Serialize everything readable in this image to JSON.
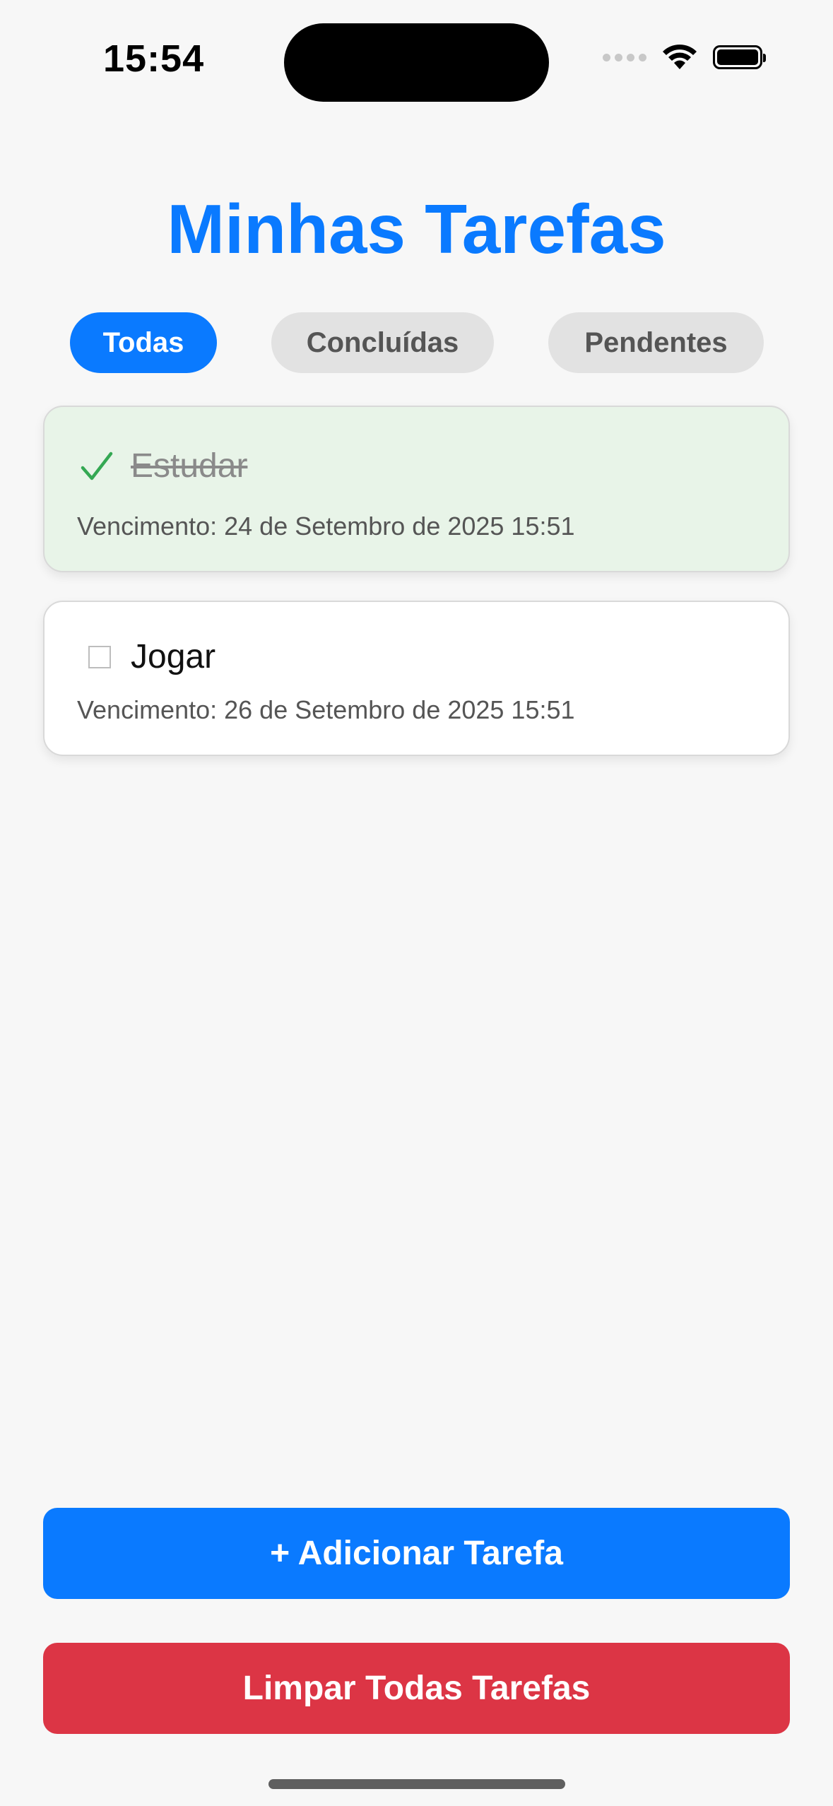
{
  "status_bar": {
    "time": "15:54",
    "wifi_icon": "wifi-icon",
    "battery_icon": "battery-icon"
  },
  "header": {
    "title": "Minhas Tarefas"
  },
  "filters": {
    "all": "Todas",
    "done": "Concluídas",
    "pending": "Pendentes",
    "selected": "Todas"
  },
  "tasks": [
    {
      "title": "Estudar",
      "due": "Vencimento: 24 de Setembro de 2025 15:51",
      "completed": true,
      "icon": "checkmark-icon"
    },
    {
      "title": "Jogar",
      "due": "Vencimento: 26 de Setembro de 2025 15:51",
      "completed": false,
      "icon": "checkbox-icon"
    }
  ],
  "actions": {
    "add": "+ Adicionar Tarefa",
    "clear": "Limpar Todas Tarefas"
  },
  "colors": {
    "accent": "#0a7aff",
    "danger": "#dc3545",
    "success": "#34a853",
    "completed_card": "#e8f4e8"
  }
}
